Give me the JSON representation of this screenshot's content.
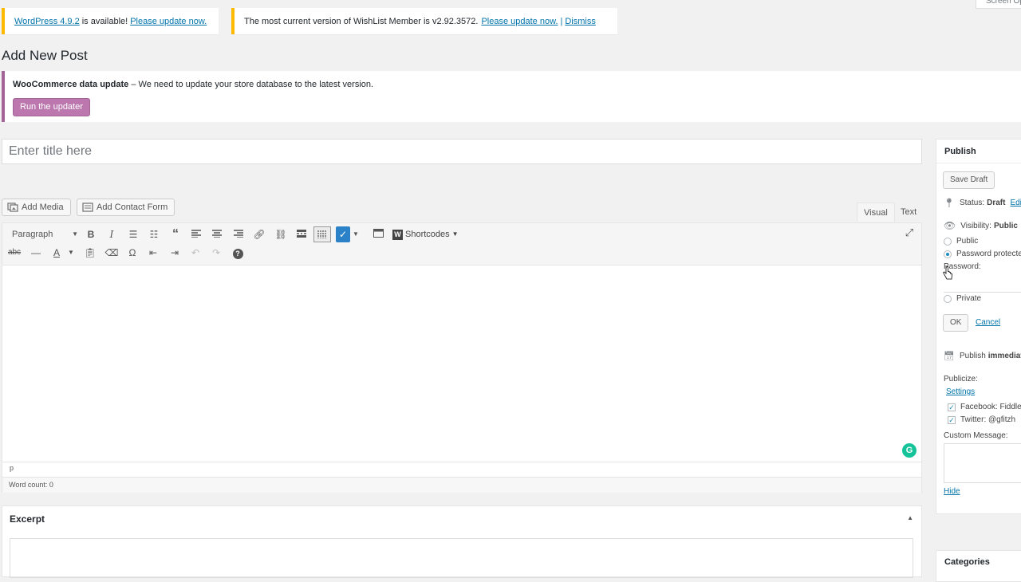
{
  "notices": {
    "wp_update": {
      "version_link": "WordPress 4.9.2",
      "text": "is available!",
      "action_link": "Please update now."
    },
    "wishlist": {
      "text": "The most current version of WishList Member is v2.92.3572.",
      "action_link": "Please update now.",
      "separator": "|",
      "dismiss": "Dismiss"
    },
    "screen_options": "Screen Options"
  },
  "page_title": "Add New Post",
  "woocommerce": {
    "bold": "WooCommerce data update",
    "text": " – We need to update your store database to the latest version.",
    "button": "Run the updater",
    "accent_color": "#a46497"
  },
  "title_field": {
    "placeholder": "Enter title here"
  },
  "media_buttons": {
    "add_media": "Add Media",
    "add_contact_form": "Add Contact Form"
  },
  "editor_tabs": {
    "visual": "Visual",
    "text": "Text"
  },
  "toolbar": {
    "format_select": "Paragraph",
    "shortcodes": "Shortcodes",
    "row1_icons": [
      "bold-icon",
      "italic-icon",
      "bullet-list-icon",
      "numbered-list-icon",
      "blockquote-icon",
      "align-left-icon",
      "align-center-icon",
      "align-right-icon",
      "link-icon",
      "unlink-icon",
      "read-more-icon",
      "toolbar-toggle-icon",
      "mailchimp-icon",
      "form-icon",
      "shortcodes-icon",
      "fullscreen-icon"
    ],
    "row2_icons": [
      "strikethrough-icon",
      "horizontal-rule-icon",
      "text-color-icon",
      "paste-text-icon",
      "clear-formatting-icon",
      "special-character-icon",
      "outdent-icon",
      "indent-icon",
      "undo-icon",
      "redo-icon",
      "help-icon"
    ]
  },
  "editor": {
    "path": "p",
    "word_count": "Word count: 0"
  },
  "excerpt": {
    "title": "Excerpt"
  },
  "publish": {
    "title": "Publish",
    "save_draft": "Save Draft",
    "status_label": "Status:",
    "status_value": "Draft",
    "status_edit": "Edit",
    "visibility_label": "Visibility:",
    "visibility_value": "Public",
    "options": {
      "public": "Public",
      "password": "Password protected",
      "private": "Private"
    },
    "password_label": "Password:",
    "ok": "OK",
    "cancel": "Cancel",
    "publish_time": "Publish",
    "publish_time_value": "immediately",
    "publicize_label": "Publicize:",
    "settings_link": "Settings",
    "facebook": "Facebook: Fiddle",
    "twitter": "Twitter: @gfitzh",
    "custom_message": "Custom Message:",
    "hide": "Hide"
  },
  "categories": {
    "title": "Categories"
  }
}
